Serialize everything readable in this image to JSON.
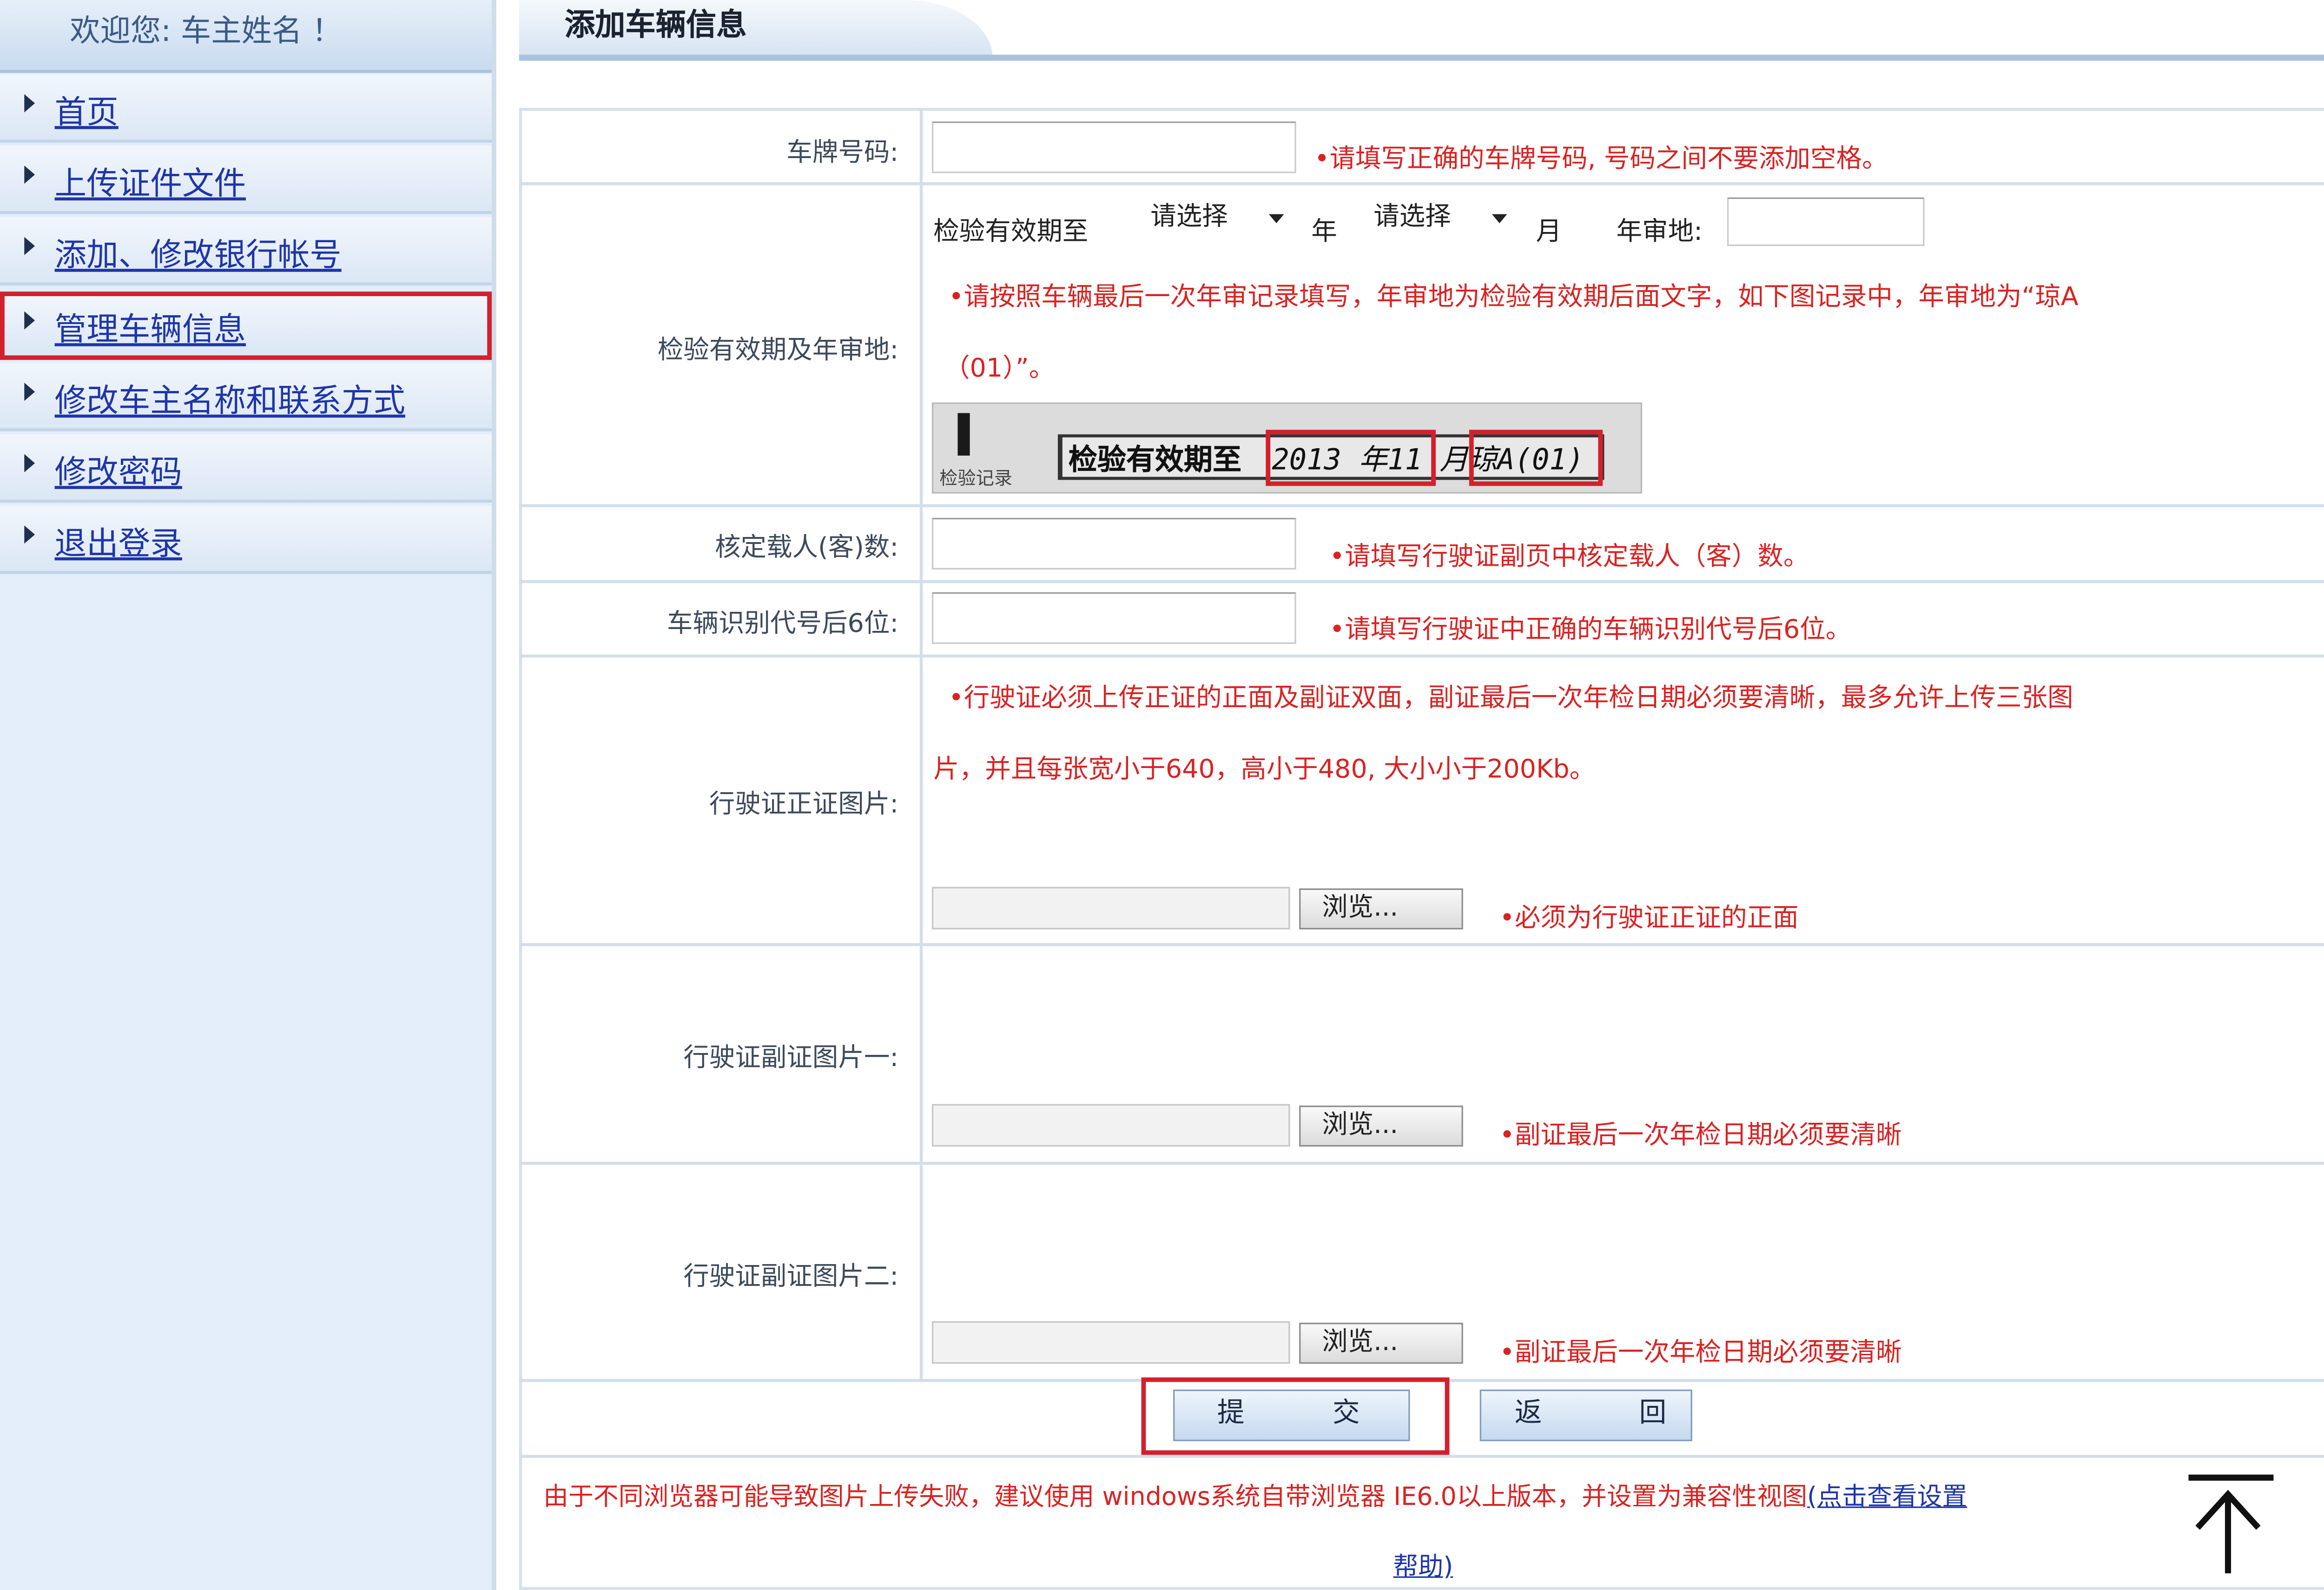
{
  "sidebar": {
    "welcome": "欢迎您: 车主姓名 ！",
    "items": [
      {
        "label": "首页"
      },
      {
        "label": "上传证件文件"
      },
      {
        "label": "添加、修改银行帐号"
      },
      {
        "label": "管理车辆信息"
      },
      {
        "label": "修改车主名称和联系方式"
      },
      {
        "label": "修改密码"
      },
      {
        "label": "退出登录"
      }
    ]
  },
  "header": {
    "title": "添加车辆信息"
  },
  "form": {
    "plate": {
      "label": "车牌号码:",
      "value": "",
      "hint": "•请填写正确的车牌号码, 号码之间不要添加空格。"
    },
    "inspection": {
      "label": "检验有效期及年审地:",
      "prefix": "检验有效期至",
      "year_select": "请选择",
      "year_unit": "年",
      "month_select": "请选择",
      "month_unit": "月",
      "place_label": "年审地:",
      "place_value": "",
      "hint_line1": "•请按照车辆最后一次年审记录填写，年审地为检验有效期后面文字，如下图记录中，年审地为“琼A",
      "hint_line2": "（01）”。",
      "sample": {
        "small_text": "检验记录",
        "main_text": "检验有效期至",
        "date_text": "2013 年11  月琼A(01)"
      }
    },
    "capacity": {
      "label": "核定载人(客)数:",
      "value": "",
      "hint": "•请填写行驶证副页中核定载人（客）数。"
    },
    "vin": {
      "label": "车辆识别代号后6位:",
      "value": "",
      "hint": "•请填写行驶证中正确的车辆识别代号后6位。"
    },
    "license_front": {
      "label": "行驶证正证图片:",
      "hint_line1": "•行驶证必须上传正证的正面及副证双面，副证最后一次年检日期必须要清晰，最多允许上传三张图",
      "hint_line2": "片，并且每张宽小于640，高小于480, 大小小于200Kb。",
      "browse": "浏览...",
      "note": "•必须为行驶证正证的正面"
    },
    "license_sub1": {
      "label": "行驶证副证图片一:",
      "browse": "浏览...",
      "note": "•副证最后一次年检日期必须要清晰"
    },
    "license_sub2": {
      "label": "行驶证副证图片二:",
      "browse": "浏览...",
      "note": "•副证最后一次年检日期必须要清晰"
    },
    "buttons": {
      "submit_c1": "提",
      "submit_c2": "交",
      "back_c1": "返",
      "back_c2": "回"
    },
    "footer": {
      "text": "由于不同浏览器可能导致图片上传失败，建议使用 windows系统自带浏览器 IE6.0以上版本，并设置为兼容性视图",
      "link": "(点击查看设置",
      "link2": "帮助)"
    }
  }
}
